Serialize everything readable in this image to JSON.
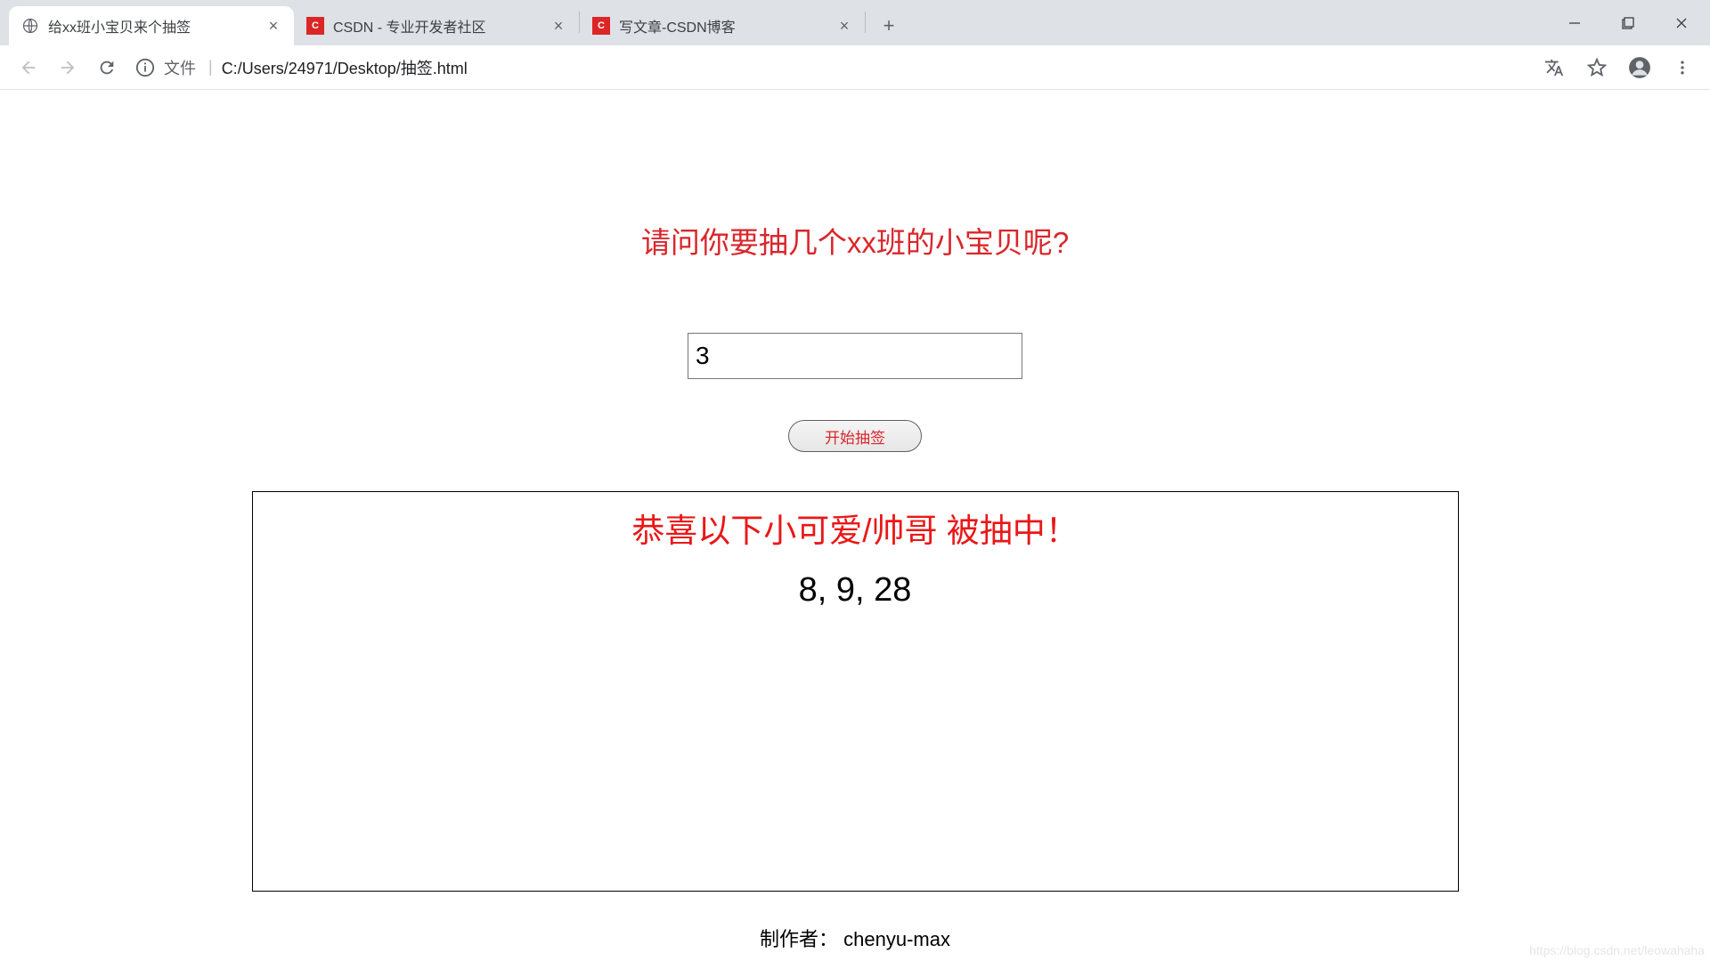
{
  "browser": {
    "tabs": [
      {
        "title": "给xx班小宝贝来个抽签",
        "active": true,
        "favicon": "globe"
      },
      {
        "title": "CSDN - 专业开发者社区",
        "active": false,
        "favicon": "csdn"
      },
      {
        "title": "写文章-CSDN博客",
        "active": false,
        "favicon": "csdn"
      }
    ],
    "url_prefix": "文件",
    "url_path": "C:/Users/24971/Desktop/抽签.html"
  },
  "page": {
    "question": "请问你要抽几个xx班的小宝贝呢?",
    "input_value": "3",
    "start_label": "开始抽签",
    "result_title": "恭喜以下小可爱/帅哥 被抽中！",
    "result_numbers": "8, 9, 28",
    "author": "制作者： chenyu-max",
    "watermark": "https://blog.csdn.net/leowahaha"
  }
}
